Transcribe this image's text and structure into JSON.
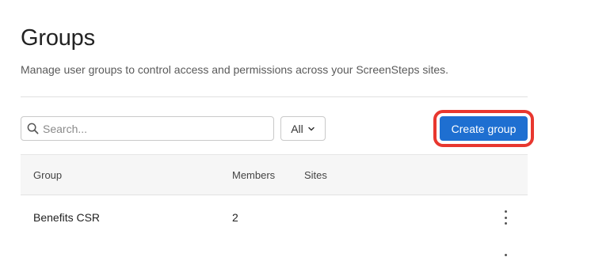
{
  "page": {
    "title": "Groups",
    "subtitle": "Manage user groups to control access and permissions across your ScreenSteps sites."
  },
  "toolbar": {
    "search_placeholder": "Search...",
    "search_icon": "search-icon",
    "filter_value": "All",
    "filter_icon": "chevron-down-icon",
    "create_label": "Create group",
    "create_color": "#1e6fd1",
    "highlight_color": "#e8372f"
  },
  "table": {
    "headers": {
      "group": "Group",
      "members": "Members",
      "sites": "Sites"
    },
    "rows": [
      {
        "group": "Benefits CSR",
        "members": "2",
        "sites": ""
      }
    ],
    "row_menu_icon": "more-vertical-icon"
  }
}
